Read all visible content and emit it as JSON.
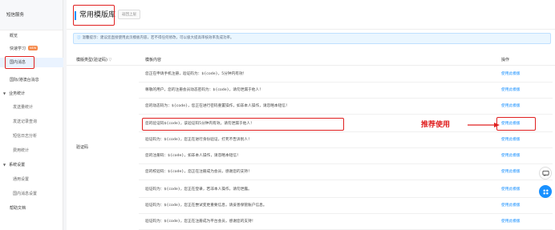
{
  "sidebar": {
    "title": "短信服务",
    "items": [
      {
        "label": "概览"
      },
      {
        "label": "快速学习",
        "badge": "NEW"
      },
      {
        "label": "国内消息"
      },
      {
        "label": "国际/港澳台消息"
      }
    ],
    "groups": [
      {
        "label": "业务统计",
        "items": [
          {
            "label": "发送量统计"
          },
          {
            "label": "发送记录查询"
          },
          {
            "label": "短信日志分析"
          },
          {
            "label": "费用统计"
          }
        ]
      },
      {
        "label": "系统设置",
        "items": [
          {
            "label": "通用设置"
          },
          {
            "label": "国内消息设置"
          }
        ]
      }
    ],
    "help": "帮助文档"
  },
  "header": {
    "title": "常用模版库",
    "back_label": "返回上层"
  },
  "notice": "温馨提示：建议您直接使用此页模板内容，若不得任何修改，可以极大提高审核效率及成功率。",
  "table": {
    "headers": {
      "category": "模版类型(验证码)",
      "content": "模板内容",
      "action": "操作"
    },
    "category_value": "验证码",
    "rows": [
      {
        "content": "您正在申请手机注册，验证码为：${code}，5分钟内有效！",
        "action": "使用此模版"
      },
      {
        "content": "尊敬的用户，您的注册会员动态密码为：${code}，请勿泄漏于他人！",
        "action": "使用此模版"
      },
      {
        "content": "您的动态码为：${code}，您正在进行密码重置操作，如非本人操作，请忽略本短信！",
        "action": "使用此模版"
      },
      {
        "content": "您的验证码${code}，该验证码5分钟内有效，请勿泄漏于他人！",
        "action": "使用此模版"
      },
      {
        "content": "验证码为：${code}，您正在进行身份验证，打死不告诉别人！",
        "action": "使用此模版"
      },
      {
        "content": "您的注册码：${code}，如非本人操作，请忽略本短信！",
        "action": "使用此模版"
      },
      {
        "content": "您的校验码：${code}，您正在注册成为会员，感谢您的支持！",
        "action": "使用此模版"
      },
      {
        "content": "验证码为：${code}，您正在登录，若非本人操作，请勿泄露。",
        "action": "使用此模版"
      },
      {
        "content": "验证码为：${code}，您正在尝试变更重要信息，请妥善保管账户信息。",
        "action": "使用此模版"
      },
      {
        "content": "验证码为：${code}，您正在注册成为平台会员，感谢您的支持！",
        "action": "使用此模版"
      }
    ]
  },
  "annotation": "推荐使用",
  "colors": {
    "accent": "#1890ff",
    "highlight": "#e02020"
  }
}
